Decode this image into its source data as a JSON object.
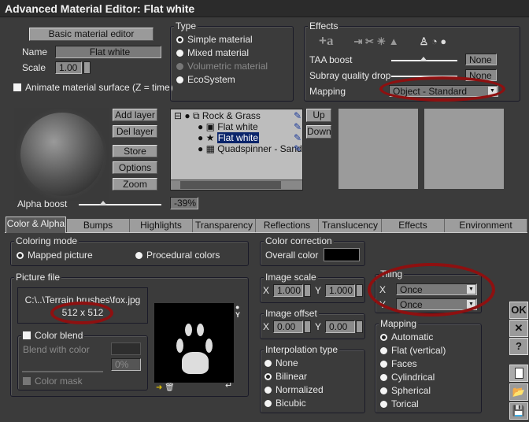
{
  "window": {
    "title": "Advanced Material Editor: Flat white"
  },
  "top": {
    "basic_editor_label": "Basic material editor",
    "name_label": "Name",
    "name_value": "Flat white",
    "scale_label": "Scale",
    "scale_value": "1.00",
    "animate_label": "Animate material surface (Z = time)",
    "animate_checked": false
  },
  "type": {
    "title": "Type",
    "options": [
      {
        "label": "Simple material",
        "selected": true
      },
      {
        "label": "Mixed material",
        "selected": false
      },
      {
        "label": "Volumetric material",
        "disabled": true
      },
      {
        "label": "EcoSystem",
        "selected": false
      }
    ]
  },
  "effects": {
    "title": "Effects",
    "taa_label": "TAA boost",
    "taa_value": "None",
    "subray_label": "Subray quality drop",
    "subray_value": "None",
    "mapping_label": "Mapping",
    "mapping_value": "Object - Standard"
  },
  "layers": {
    "add": "Add layer",
    "del": "Del layer",
    "store": "Store",
    "options": "Options",
    "zoom": "Zoom",
    "up": "Up",
    "down": "Down",
    "tree": [
      {
        "label": "Rock & Grass"
      },
      {
        "label": "Flat white"
      },
      {
        "label": "Flat white",
        "selected": true
      },
      {
        "label": "Quadspinner - Sand"
      }
    ]
  },
  "alpha": {
    "label": "Alpha boost",
    "value": "-39%"
  },
  "tabs": [
    "Color & Alpha",
    "Bumps",
    "Highlights",
    "Transparency",
    "Reflections",
    "Translucency",
    "Effects",
    "Environment"
  ],
  "coloring": {
    "title": "Coloring mode",
    "mapped": "Mapped picture",
    "procedural": "Procedural colors"
  },
  "correction": {
    "title": "Color correction",
    "overall": "Overall color",
    "color": "#000000"
  },
  "picture": {
    "title": "Picture file",
    "path": "C:\\..\\Terrain brushes\\fox.jpg",
    "size": "512 x 512",
    "blend_title": "Color blend",
    "blend_with": "Blend with color",
    "blend_pct": "0%",
    "mask": "Color mask"
  },
  "image_scale": {
    "title": "Image scale",
    "x_label": "X",
    "x": "1.000",
    "y_label": "Y",
    "y": "1.000"
  },
  "image_offset": {
    "title": "Image offset",
    "x_label": "X",
    "x": "0.00",
    "y_label": "Y",
    "y": "0.00"
  },
  "interp": {
    "title": "Interpolation type",
    "options": [
      "None",
      "Bilinear",
      "Normalized",
      "Bicubic"
    ],
    "selected": "Bilinear"
  },
  "tiling": {
    "title": "Tiling",
    "x_label": "X",
    "x": "Once",
    "y_label": "Y",
    "y": "Once"
  },
  "mapping": {
    "title": "Mapping",
    "options": [
      "Automatic",
      "Flat (vertical)",
      "Faces",
      "Cylindrical",
      "Spherical",
      "Torical"
    ],
    "selected": "Automatic"
  },
  "side": {
    "ok": "OK",
    "cancel": "✕",
    "help": "?"
  },
  "annotation_color": "#8e1010"
}
